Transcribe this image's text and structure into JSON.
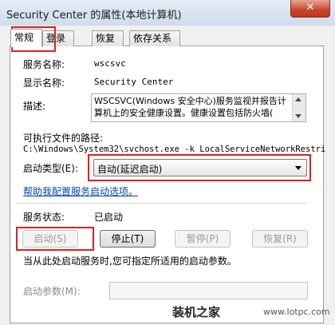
{
  "window": {
    "title": "Security Center 的属性(本地计算机)",
    "close_label": "✕"
  },
  "tabs": [
    "常规",
    "登录",
    "恢复",
    "依存关系"
  ],
  "general": {
    "service_name_label": "服务名称:",
    "service_name_value": "wscsvc",
    "display_name_label": "显示名称:",
    "display_name_value": "Security Center",
    "description_label": "描述:",
    "description_value": "WSCSVC(Windows 安全中心)服务监视并报告计算机上的安全健康设置。健康设置包括防火墙(",
    "exe_path_label": "可执行文件的路径:",
    "exe_path_value": "C:\\Windows\\System32\\svchost.exe -k LocalServiceNetworkRestri",
    "startup_type_label": "启动类型(E):",
    "startup_type_value": "自动(延迟启动)",
    "help_link": "帮助我配置服务启动选项。",
    "service_status_label": "服务状态:",
    "service_status_value": "已启动",
    "buttons": {
      "start": "启动(S)",
      "stop": "停止(T)",
      "pause": "暂停(P)",
      "resume": "恢复(R)"
    },
    "hint_text": "当从此处启动服务时,您可指定所适用的启动参数。",
    "start_params_label": "启动参数(M):",
    "start_params_value": ""
  },
  "watermark": {
    "brand": "装机之家",
    "site": "www.lotpc.com"
  },
  "colors": {
    "highlight": "#e02020",
    "link": "#0645ad"
  }
}
